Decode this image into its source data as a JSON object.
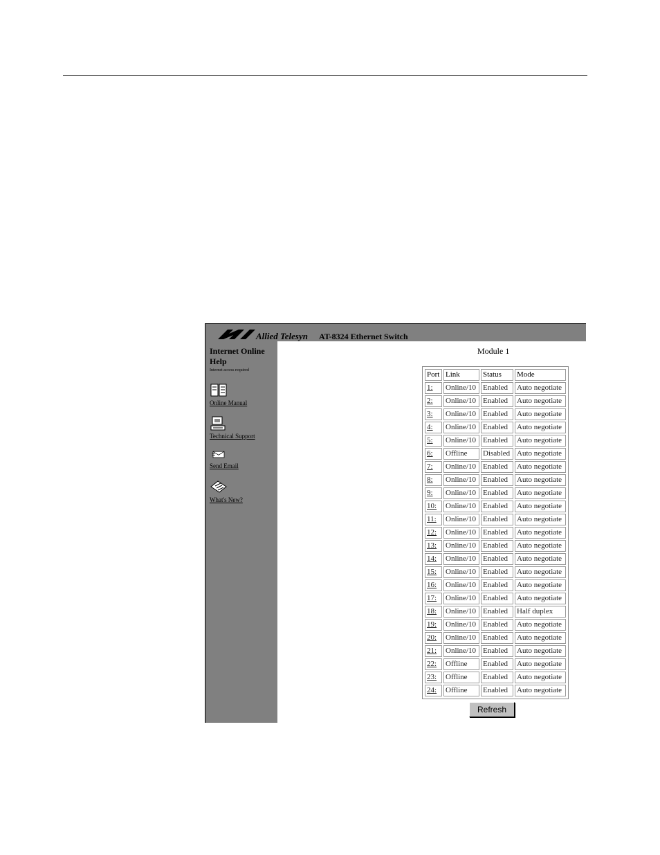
{
  "header": {
    "brand": "Allied Telesyn",
    "product": "AT-8324 Ethernet Switch"
  },
  "sidebar": {
    "title": "Internet Online Help",
    "note": "Internet access required",
    "links": [
      {
        "label": "Online Manual",
        "icon": "book-icon"
      },
      {
        "label": "Technical Support",
        "icon": "computer-icon"
      },
      {
        "label": "Send Email",
        "icon": "envelope-icon"
      },
      {
        "label": "What's New?",
        "icon": "newspaper-icon"
      }
    ]
  },
  "main": {
    "module_title": "Module 1",
    "columns": [
      "Port",
      "Link",
      "Status",
      "Mode"
    ],
    "rows": [
      [
        "1:",
        "Online/10",
        "Enabled",
        "Auto negotiate"
      ],
      [
        "2:",
        "Online/10",
        "Enabled",
        "Auto negotiate"
      ],
      [
        "3:",
        "Online/10",
        "Enabled",
        "Auto negotiate"
      ],
      [
        "4:",
        "Online/10",
        "Enabled",
        "Auto negotiate"
      ],
      [
        "5:",
        "Online/10",
        "Enabled",
        "Auto negotiate"
      ],
      [
        "6:",
        "Offline",
        "Disabled",
        "Auto negotiate"
      ],
      [
        "7:",
        "Online/10",
        "Enabled",
        "Auto negotiate"
      ],
      [
        "8:",
        "Online/10",
        "Enabled",
        "Auto negotiate"
      ],
      [
        "9:",
        "Online/10",
        "Enabled",
        "Auto negotiate"
      ],
      [
        "10:",
        "Online/10",
        "Enabled",
        "Auto negotiate"
      ],
      [
        "11:",
        "Online/10",
        "Enabled",
        "Auto negotiate"
      ],
      [
        "12:",
        "Online/10",
        "Enabled",
        "Auto negotiate"
      ],
      [
        "13:",
        "Online/10",
        "Enabled",
        "Auto negotiate"
      ],
      [
        "14:",
        "Online/10",
        "Enabled",
        "Auto negotiate"
      ],
      [
        "15:",
        "Online/10",
        "Enabled",
        "Auto negotiate"
      ],
      [
        "16:",
        "Online/10",
        "Enabled",
        "Auto negotiate"
      ],
      [
        "17:",
        "Online/10",
        "Enabled",
        "Auto negotiate"
      ],
      [
        "18:",
        "Online/10",
        "Enabled",
        "Half duplex"
      ],
      [
        "19:",
        "Online/10",
        "Enabled",
        "Auto negotiate"
      ],
      [
        "20:",
        "Online/10",
        "Enabled",
        "Auto negotiate"
      ],
      [
        "21:",
        "Online/10",
        "Enabled",
        "Auto negotiate"
      ],
      [
        "22:",
        "Offline",
        "Enabled",
        "Auto negotiate"
      ],
      [
        "23:",
        "Offline",
        "Enabled",
        "Auto negotiate"
      ],
      [
        "24:",
        "Offline",
        "Enabled",
        "Auto negotiate"
      ]
    ],
    "refresh_label": "Refresh"
  }
}
